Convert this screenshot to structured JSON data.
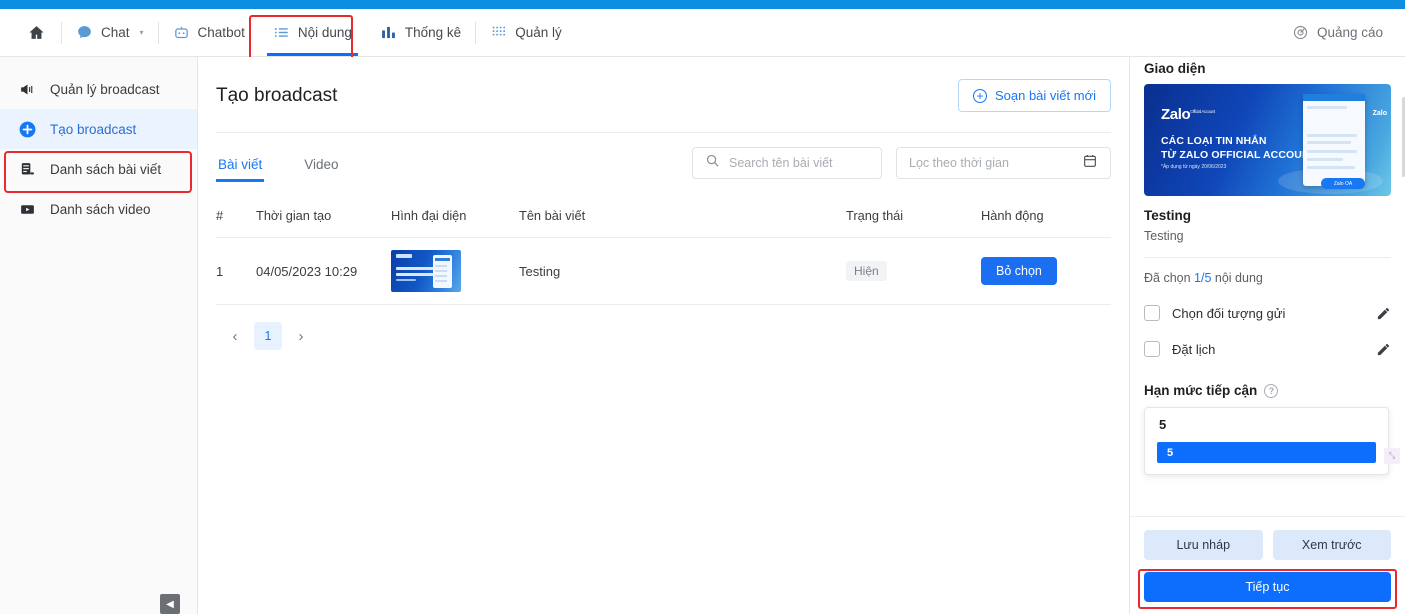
{
  "navbar": {
    "items": [
      {
        "label": "",
        "icon": "home-icon",
        "name": "nav-home"
      },
      {
        "label": "Chat",
        "icon": "chat-icon",
        "name": "nav-chat",
        "caret": "▾"
      },
      {
        "label": "Chatbot",
        "icon": "chatbot-icon",
        "name": "nav-chatbot"
      },
      {
        "label": "Nội dung",
        "icon": "list-icon",
        "name": "nav-noidung"
      },
      {
        "label": "Thống kê",
        "icon": "bar-chart-icon",
        "name": "nav-thongke"
      },
      {
        "label": "Quản lý",
        "icon": "grid-icon",
        "name": "nav-quanly"
      }
    ],
    "right": {
      "label": "Quảng cáo",
      "icon": "target-icon"
    }
  },
  "sidebar": {
    "items": [
      {
        "label": "Quản lý broadcast",
        "icon": "megaphone-icon"
      },
      {
        "label": "Tạo broadcast",
        "icon": "plus-circle-icon"
      },
      {
        "label": "Danh sách bài viết",
        "icon": "article-list-icon"
      },
      {
        "label": "Danh sách video",
        "icon": "video-icon"
      }
    ],
    "collapse_glyph": "◀"
  },
  "content": {
    "page_title": "Tạo broadcast",
    "compose_button": "Soạn bài viết mới",
    "tabs": [
      {
        "label": "Bài viết",
        "active": true
      },
      {
        "label": "Video",
        "active": false
      }
    ],
    "search": {
      "placeholder": "Search tên bài viết"
    },
    "date_filter": {
      "placeholder": "Lọc theo thời gian"
    },
    "table": {
      "headers": [
        "#",
        "Thời gian tạo",
        "Hình đại diện",
        "Tên bài viết",
        "Trạng thái",
        "Hành động"
      ],
      "rows": [
        {
          "index": "1",
          "created": "04/05/2023 10:29",
          "thumbnail": "zalo-banner-thumbnail",
          "name": "Testing",
          "status": "Hiện",
          "action": "Bỏ chọn"
        }
      ]
    },
    "pagination": {
      "prev": "‹",
      "pages": [
        "1"
      ],
      "next": "›"
    }
  },
  "right_panel": {
    "title": "Giao diện",
    "preview": {
      "brand": "Zalo",
      "brand_sup": "Official Account",
      "headline_line1": "CÁC LOẠI TIN NHẮN",
      "headline_line2": "TỪ ZALO OFFICIAL ACCOUNT",
      "subline": "*Áp dụng từ ngày 20/06/2023",
      "badge": "Zalo",
      "cta": "Zalo OA"
    },
    "item_name": "Testing",
    "item_desc": "Testing",
    "selected_prefix": "Đã chọn ",
    "selected_count": "1/5",
    "selected_suffix": " nội dung",
    "checkboxes": [
      {
        "label": "Chọn đối tượng gửi",
        "checked": false
      },
      {
        "label": "Đặt lịch",
        "checked": false
      }
    ],
    "limit": {
      "label": "Hạn mức tiếp cận",
      "help": "?",
      "value": "5",
      "options": [
        "5"
      ]
    },
    "footer": {
      "save_draft": "Lưu nháp",
      "preview": "Xem trước",
      "continue": "Tiếp tục"
    }
  },
  "colors": {
    "brand_blue": "#0d6efd",
    "top_strip": "#0d8ee0",
    "annotation_red": "#e8292e",
    "active_tab": "#1877f2"
  }
}
